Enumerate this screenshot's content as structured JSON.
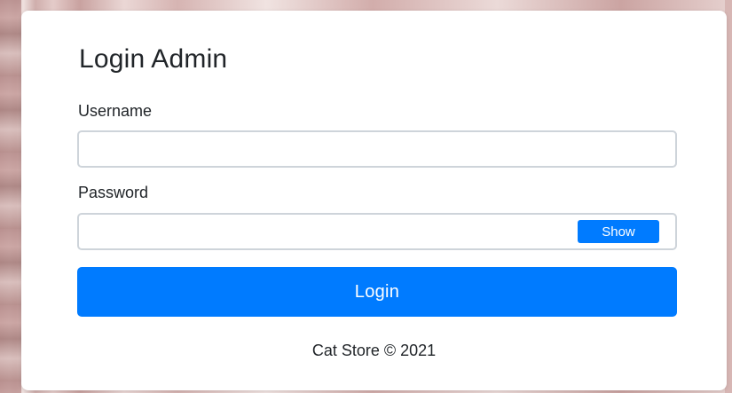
{
  "login_card": {
    "title": "Login Admin",
    "username": {
      "label": "Username",
      "value": "",
      "placeholder": ""
    },
    "password": {
      "label": "Password",
      "value": "",
      "placeholder": "",
      "show_label": "Show"
    },
    "submit_label": "Login",
    "footer": "Cat Store © 2021"
  },
  "colors": {
    "accent": "#007bff",
    "card_background": "#ffffff",
    "text": "#212529",
    "input_border": "#ced4da"
  }
}
